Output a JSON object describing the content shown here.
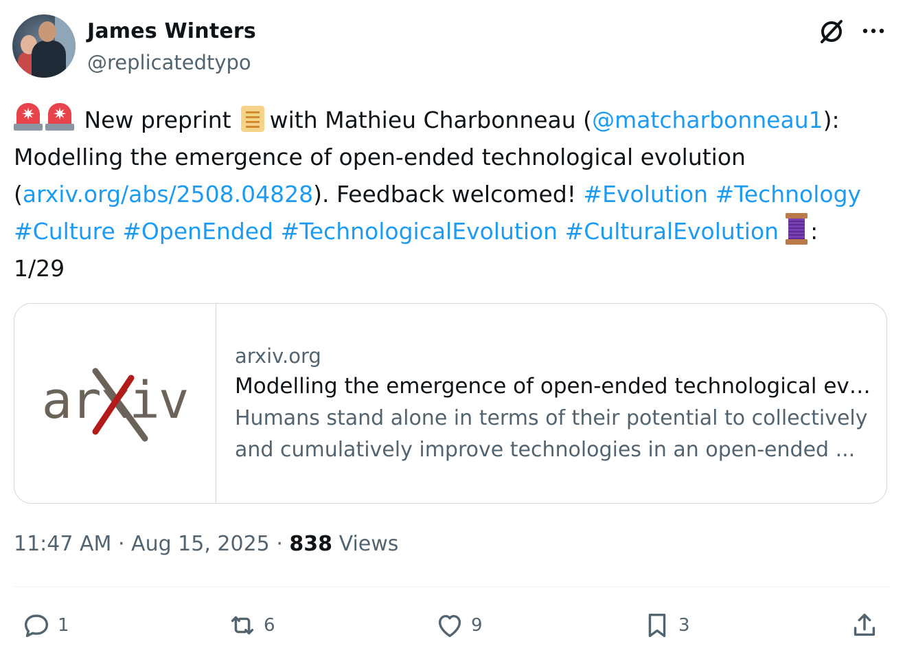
{
  "author": {
    "name": "James Winters",
    "handle": "@replicatedtypo"
  },
  "tweet": {
    "text_1": "New preprint",
    "text_2": "with Mathieu Charbonneau (",
    "mention": "@matcharbonneau1",
    "text_3": "): Modelling the emergence of open-ended technological evolution (",
    "link": "arxiv.org/abs/2508.04828",
    "text_4": "). Feedback welcomed!",
    "hashtags": [
      "#Evolution",
      "#Technology",
      "#Culture",
      "#OpenEnded",
      "#TechnologicalEvolution",
      "#CulturalEvolution"
    ],
    "text_5": ":",
    "thread_counter": "1/29",
    "emoji_names": [
      "rotating-light-icon",
      "scroll-icon",
      "thread-icon"
    ]
  },
  "card": {
    "thumbnail_logo": "arXiv",
    "domain": "arxiv.org",
    "title": "Modelling the emergence of open-ended technological evol...",
    "description": "Humans stand alone in terms of their potential to collectively and cumulatively improve technologies in an open-ended ..."
  },
  "meta": {
    "time": "11:47 AM",
    "separator": "·",
    "date": "Aug 15, 2025",
    "views_count": "838",
    "views_label": "Views"
  },
  "actions": {
    "replies": "1",
    "reposts": "6",
    "likes": "9",
    "bookmarks": "3"
  },
  "colors": {
    "link": "#1d9bf0",
    "secondary_text": "#536471",
    "primary_text": "#0f1419",
    "border": "#cfd9de"
  }
}
